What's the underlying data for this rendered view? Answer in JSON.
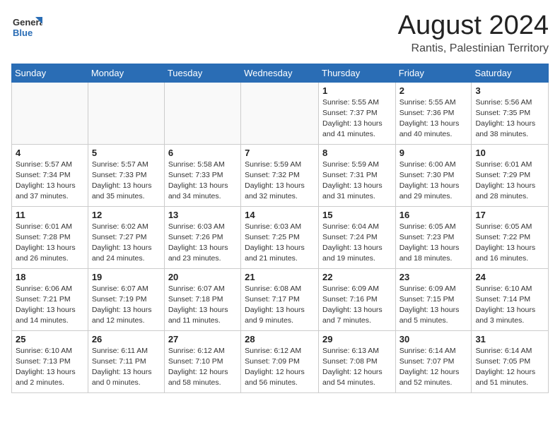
{
  "header": {
    "logo_general": "General",
    "logo_blue": "Blue",
    "month_title": "August 2024",
    "location": "Rantis, Palestinian Territory"
  },
  "days_of_week": [
    "Sunday",
    "Monday",
    "Tuesday",
    "Wednesday",
    "Thursday",
    "Friday",
    "Saturday"
  ],
  "weeks": [
    [
      {
        "day": "",
        "info": ""
      },
      {
        "day": "",
        "info": ""
      },
      {
        "day": "",
        "info": ""
      },
      {
        "day": "",
        "info": ""
      },
      {
        "day": "1",
        "info": "Sunrise: 5:55 AM\nSunset: 7:37 PM\nDaylight: 13 hours\nand 41 minutes."
      },
      {
        "day": "2",
        "info": "Sunrise: 5:55 AM\nSunset: 7:36 PM\nDaylight: 13 hours\nand 40 minutes."
      },
      {
        "day": "3",
        "info": "Sunrise: 5:56 AM\nSunset: 7:35 PM\nDaylight: 13 hours\nand 38 minutes."
      }
    ],
    [
      {
        "day": "4",
        "info": "Sunrise: 5:57 AM\nSunset: 7:34 PM\nDaylight: 13 hours\nand 37 minutes."
      },
      {
        "day": "5",
        "info": "Sunrise: 5:57 AM\nSunset: 7:33 PM\nDaylight: 13 hours\nand 35 minutes."
      },
      {
        "day": "6",
        "info": "Sunrise: 5:58 AM\nSunset: 7:33 PM\nDaylight: 13 hours\nand 34 minutes."
      },
      {
        "day": "7",
        "info": "Sunrise: 5:59 AM\nSunset: 7:32 PM\nDaylight: 13 hours\nand 32 minutes."
      },
      {
        "day": "8",
        "info": "Sunrise: 5:59 AM\nSunset: 7:31 PM\nDaylight: 13 hours\nand 31 minutes."
      },
      {
        "day": "9",
        "info": "Sunrise: 6:00 AM\nSunset: 7:30 PM\nDaylight: 13 hours\nand 29 minutes."
      },
      {
        "day": "10",
        "info": "Sunrise: 6:01 AM\nSunset: 7:29 PM\nDaylight: 13 hours\nand 28 minutes."
      }
    ],
    [
      {
        "day": "11",
        "info": "Sunrise: 6:01 AM\nSunset: 7:28 PM\nDaylight: 13 hours\nand 26 minutes."
      },
      {
        "day": "12",
        "info": "Sunrise: 6:02 AM\nSunset: 7:27 PM\nDaylight: 13 hours\nand 24 minutes."
      },
      {
        "day": "13",
        "info": "Sunrise: 6:03 AM\nSunset: 7:26 PM\nDaylight: 13 hours\nand 23 minutes."
      },
      {
        "day": "14",
        "info": "Sunrise: 6:03 AM\nSunset: 7:25 PM\nDaylight: 13 hours\nand 21 minutes."
      },
      {
        "day": "15",
        "info": "Sunrise: 6:04 AM\nSunset: 7:24 PM\nDaylight: 13 hours\nand 19 minutes."
      },
      {
        "day": "16",
        "info": "Sunrise: 6:05 AM\nSunset: 7:23 PM\nDaylight: 13 hours\nand 18 minutes."
      },
      {
        "day": "17",
        "info": "Sunrise: 6:05 AM\nSunset: 7:22 PM\nDaylight: 13 hours\nand 16 minutes."
      }
    ],
    [
      {
        "day": "18",
        "info": "Sunrise: 6:06 AM\nSunset: 7:21 PM\nDaylight: 13 hours\nand 14 minutes."
      },
      {
        "day": "19",
        "info": "Sunrise: 6:07 AM\nSunset: 7:19 PM\nDaylight: 13 hours\nand 12 minutes."
      },
      {
        "day": "20",
        "info": "Sunrise: 6:07 AM\nSunset: 7:18 PM\nDaylight: 13 hours\nand 11 minutes."
      },
      {
        "day": "21",
        "info": "Sunrise: 6:08 AM\nSunset: 7:17 PM\nDaylight: 13 hours\nand 9 minutes."
      },
      {
        "day": "22",
        "info": "Sunrise: 6:09 AM\nSunset: 7:16 PM\nDaylight: 13 hours\nand 7 minutes."
      },
      {
        "day": "23",
        "info": "Sunrise: 6:09 AM\nSunset: 7:15 PM\nDaylight: 13 hours\nand 5 minutes."
      },
      {
        "day": "24",
        "info": "Sunrise: 6:10 AM\nSunset: 7:14 PM\nDaylight: 13 hours\nand 3 minutes."
      }
    ],
    [
      {
        "day": "25",
        "info": "Sunrise: 6:10 AM\nSunset: 7:13 PM\nDaylight: 13 hours\nand 2 minutes."
      },
      {
        "day": "26",
        "info": "Sunrise: 6:11 AM\nSunset: 7:11 PM\nDaylight: 13 hours\nand 0 minutes."
      },
      {
        "day": "27",
        "info": "Sunrise: 6:12 AM\nSunset: 7:10 PM\nDaylight: 12 hours\nand 58 minutes."
      },
      {
        "day": "28",
        "info": "Sunrise: 6:12 AM\nSunset: 7:09 PM\nDaylight: 12 hours\nand 56 minutes."
      },
      {
        "day": "29",
        "info": "Sunrise: 6:13 AM\nSunset: 7:08 PM\nDaylight: 12 hours\nand 54 minutes."
      },
      {
        "day": "30",
        "info": "Sunrise: 6:14 AM\nSunset: 7:07 PM\nDaylight: 12 hours\nand 52 minutes."
      },
      {
        "day": "31",
        "info": "Sunrise: 6:14 AM\nSunset: 7:05 PM\nDaylight: 12 hours\nand 51 minutes."
      }
    ]
  ]
}
